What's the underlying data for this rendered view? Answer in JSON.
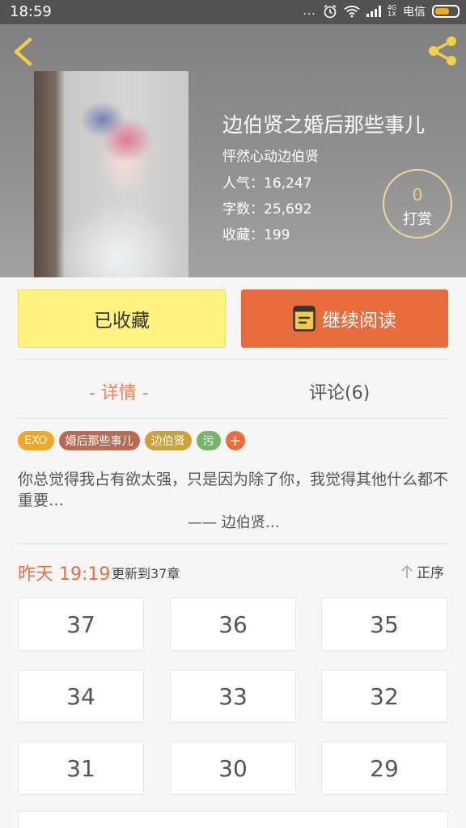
{
  "status_bar": {
    "time": "18:59",
    "dots": "...",
    "network": [
      "4G",
      "1X"
    ],
    "carrier": "电信"
  },
  "colors": {
    "accent": "#e86c3c",
    "favorite": "#fff27e",
    "tip_ring": "#f1d79a"
  },
  "book": {
    "title": "边伯贤之婚后那些事儿",
    "author": "怦然心动边伯贤",
    "popularity": "人气：16,247",
    "word_count": "字数：25,692",
    "favorites": "收藏：199",
    "tip": {
      "count": "0",
      "label": "打赏"
    }
  },
  "actions": {
    "favorite_label": "已收藏",
    "read_label": "继续阅读"
  },
  "tabs": [
    {
      "label": "- 详情 -",
      "active": true
    },
    {
      "label": "评论(6)",
      "active": false
    }
  ],
  "tags": [
    {
      "label": "EXO",
      "color": "#f3a624"
    },
    {
      "label": "婚后那些事儿",
      "color": "#b86a54"
    },
    {
      "label": "边伯贤",
      "color": "#c9a23c"
    },
    {
      "label": "污",
      "color": "#76b56a"
    }
  ],
  "tag_add": "+",
  "intro": {
    "text": "你总觉得我占有欲太强，只是因为除了你，我觉得其他什么都不重要…",
    "signature": "—— 边伯贤…"
  },
  "update": {
    "time": "昨天 19:19",
    "note": "更新到37章",
    "order_label": "正序"
  },
  "chapters": [
    "37",
    "36",
    "35",
    "34",
    "33",
    "32",
    "31",
    "30",
    "29"
  ]
}
